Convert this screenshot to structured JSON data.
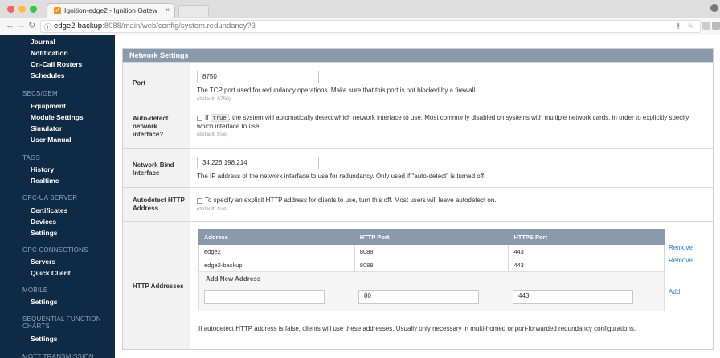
{
  "browser": {
    "tab_title": "Ignition-edge2 - Ignition Gatew",
    "url_host": "edge2-backup",
    "url_path": ":8088/main/web/config/system.redundancy?3"
  },
  "sidebar": {
    "items": [
      {
        "type": "item",
        "label": "Journal"
      },
      {
        "type": "item",
        "label": "Notification"
      },
      {
        "type": "item",
        "label": "On-Call Rosters"
      },
      {
        "type": "item",
        "label": "Schedules"
      },
      {
        "type": "section",
        "label": "SECS/GEM"
      },
      {
        "type": "item",
        "label": "Equipment"
      },
      {
        "type": "item",
        "label": "Module Settings"
      },
      {
        "type": "item",
        "label": "Simulator"
      },
      {
        "type": "item",
        "label": "User Manual"
      },
      {
        "type": "section",
        "label": "TAGS"
      },
      {
        "type": "item",
        "label": "History"
      },
      {
        "type": "item",
        "label": "Realtime"
      },
      {
        "type": "section",
        "label": "OPC-UA SERVER"
      },
      {
        "type": "item",
        "label": "Certificates"
      },
      {
        "type": "item",
        "label": "Devices"
      },
      {
        "type": "item",
        "label": "Settings"
      },
      {
        "type": "section",
        "label": "OPC CONNECTIONS"
      },
      {
        "type": "item",
        "label": "Servers"
      },
      {
        "type": "item",
        "label": "Quick Client"
      },
      {
        "type": "section",
        "label": "MOBILE"
      },
      {
        "type": "item",
        "label": "Settings"
      },
      {
        "type": "section",
        "label": "SEQUENTIAL FUNCTION"
      },
      {
        "type": "section",
        "label": "CHARTS"
      },
      {
        "type": "item",
        "label": "Settings"
      },
      {
        "type": "section",
        "label": "MQTT TRANSMISSION"
      }
    ]
  },
  "panel": {
    "title": "Network Settings",
    "port": {
      "label": "Port",
      "value": "8750",
      "desc": "The TCP port used for redundancy operations. Make sure that this port is not blocked by a firewall.",
      "default": "(default: 8750)"
    },
    "auto_detect": {
      "label": "Auto-detect network interface?",
      "desc_pre": "If",
      "code": "true",
      "desc_post": ", the system will automatically detect which network interface to use. Most commonly disabled on systems with multiple network cards, in order to explicitly specify",
      "desc_line2": "which interface to use.",
      "default": "(default: true)"
    },
    "bind": {
      "label": "Network Bind Interface",
      "value": "34.226.198.214",
      "desc": "The IP address of the network interface to use for redundancy. Only used if \"auto-detect\" is turned off."
    },
    "autodetect_http": {
      "label": "Autodetect HTTP Address",
      "desc": "To specify an explicit HTTP address for clients to use, turn this off. Most users will leave autodetect on.",
      "default": "(default: true)"
    },
    "http": {
      "label": "HTTP Addresses",
      "headers": [
        "Address",
        "HTTP Port",
        "HTTPS Port"
      ],
      "rows": [
        [
          "edge2",
          "8088",
          "443"
        ],
        [
          "edge2-backup",
          "8088",
          "443"
        ]
      ],
      "remove_label": "Remove",
      "add_new_title": "Add New Address",
      "new_address": "",
      "new_http": "80",
      "new_https": "443",
      "add_label": "Add",
      "desc": "If autodetect HTTP address is false, clients will use these addresses. Usually only necessary in multi-homed or port-forwarded redundancy configurations."
    }
  }
}
